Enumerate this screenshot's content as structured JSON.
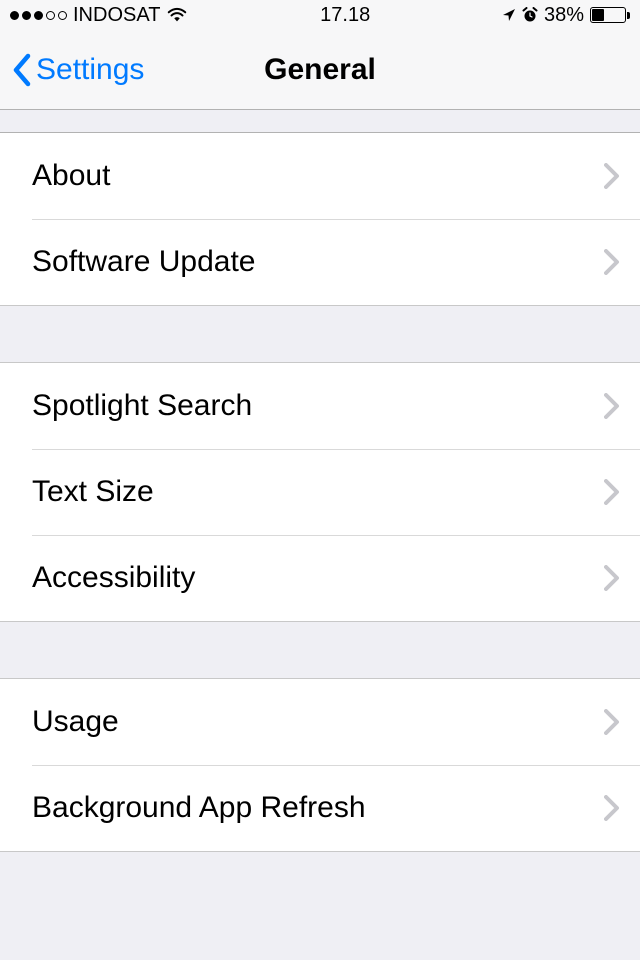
{
  "status": {
    "carrier": "INDOSAT",
    "time": "17.18",
    "battery_pct": "38%",
    "battery_level": 38
  },
  "nav": {
    "back_label": "Settings",
    "title": "General"
  },
  "groups": [
    {
      "rows": [
        {
          "label": "About"
        },
        {
          "label": "Software Update"
        }
      ]
    },
    {
      "rows": [
        {
          "label": "Spotlight Search"
        },
        {
          "label": "Text Size"
        },
        {
          "label": "Accessibility"
        }
      ]
    },
    {
      "rows": [
        {
          "label": "Usage"
        },
        {
          "label": "Background App Refresh"
        }
      ]
    }
  ]
}
